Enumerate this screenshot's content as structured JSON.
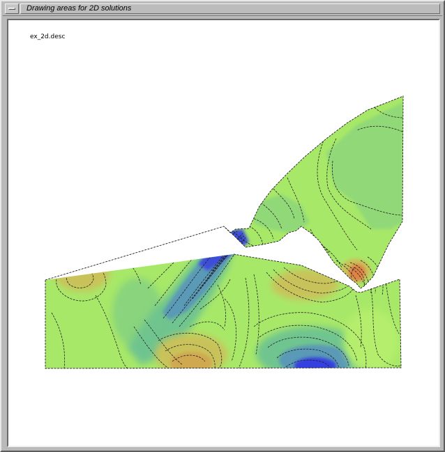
{
  "window": {
    "title": "Drawing areas for 2D solutions",
    "menu_icon": "window-menu-icon"
  },
  "drawing": {
    "file_label": "ex_2d.desc",
    "colors": {
      "base": "#a8e868",
      "pale": "#b4ee6c",
      "mid_green": "#90d878",
      "teal": "#6fc48f",
      "steel": "#5a9ab6",
      "blue": "#3c4ed8",
      "blue_deep": "#3441e0",
      "olive": "#c9c25a",
      "tan": "#d0a850",
      "orange": "#df8244",
      "contour": "#202020"
    }
  }
}
